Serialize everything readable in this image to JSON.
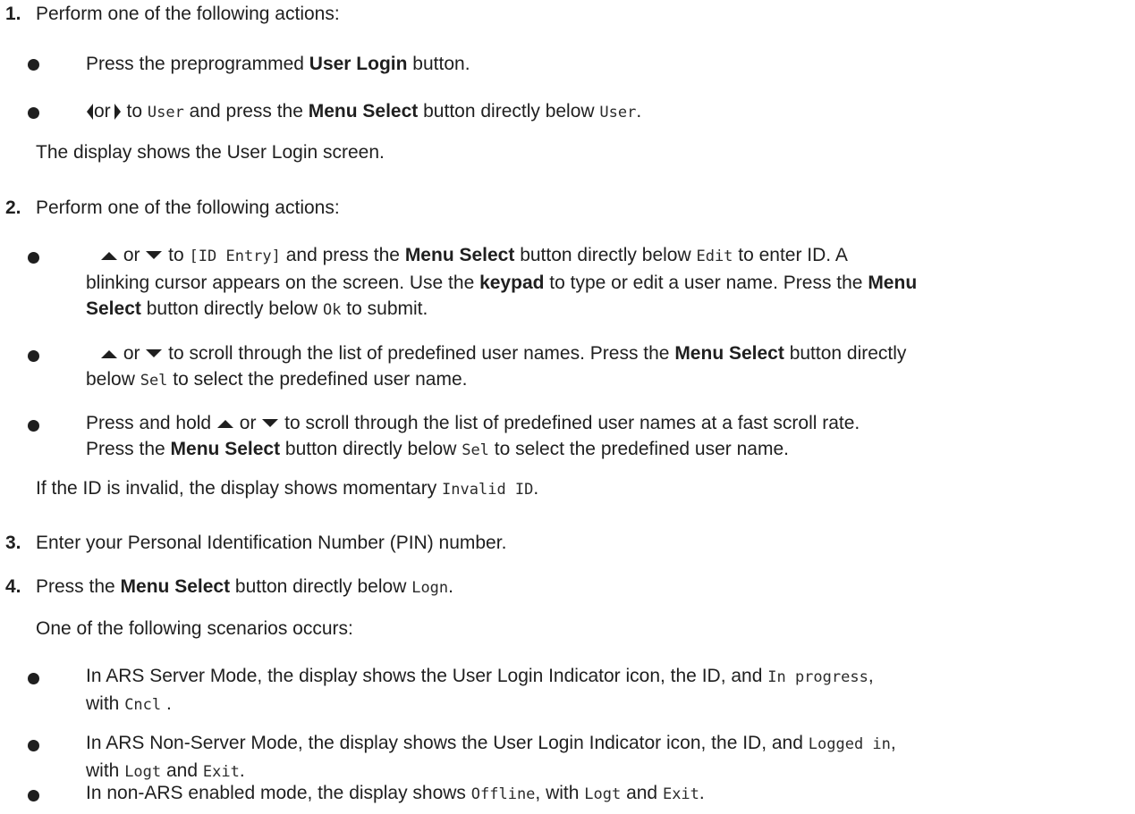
{
  "steps": [
    {
      "number": "1.",
      "text": "Perform one of the following actions:"
    },
    {
      "number": "2.",
      "text": "Perform one of the following actions:"
    },
    {
      "number": "3.",
      "text": "Enter your Personal Identification Number (PIN) number."
    },
    {
      "number": "4.",
      "text": "Press the "
    }
  ],
  "step1": {
    "b1": {
      "pre": "Press the preprogrammed ",
      "bold": "User Login",
      "post": " button."
    },
    "b2": {
      "or": "or",
      "to": " to ",
      "code1": "User",
      "mid": " and press the ",
      "bold": "Menu Select",
      "mid2": " button directly below ",
      "code2": "User",
      "end": "."
    },
    "after": "The display shows the User Login screen."
  },
  "step2": {
    "b1": {
      "or": " or ",
      "to": " to ",
      "code1": "[ID Entry]",
      "mid": " and press the ",
      "bold1": "Menu Select",
      "mid2": " button directly below ",
      "code2": "Edit",
      "mid3": " to enter ID. A",
      "line2a": "blinking cursor appears on the screen. Use the ",
      "bold2": "keypad",
      "line2b": " to type or edit a user name. Press the ",
      "bold3": "Menu",
      "bold4": "Select",
      "line3": " button directly below ",
      "code3": "Ok",
      "end": " to submit."
    },
    "b2": {
      "or": " or ",
      "line1": " to scroll through the list of predefined user names. Press the ",
      "bold": "Menu Select",
      "line1b": " button directly",
      "line2": "below ",
      "code": "Sel",
      "end": " to select the predefined user name."
    },
    "b3": {
      "pre": "Press and hold ",
      "or": " or ",
      "line1": " to scroll through the list of predefined user names at a fast scroll rate.",
      "line2": "Press the ",
      "bold": "Menu Select",
      "line2b": " button directly below ",
      "code": "Sel",
      "end": " to select the predefined user name."
    },
    "after_pre": "If the ID is invalid, the display shows momentary ",
    "after_code": "Invalid ID",
    "after_end": "."
  },
  "step4": {
    "bold": "Menu Select",
    "mid": " button directly below ",
    "code": "Logn",
    "end": ".",
    "sub": "One of the following scenarios occurs:",
    "b1": {
      "pre": "In ARS Server Mode, the display shows the User Login Indicator icon, the ID, and ",
      "code1": "In progress",
      "comma": ",",
      "line2": "with ",
      "code2": "Cncl",
      "end": " ."
    },
    "b2": {
      "pre": "In ARS Non-Server Mode, the display shows the User Login Indicator icon, the ID, and ",
      "code1": "Logged in",
      "comma": ",",
      "line2": "with ",
      "code2": "Logt",
      "and": " and ",
      "code3": "Exit",
      "end": "."
    },
    "b3": {
      "pre": "In non-ARS enabled mode, the display shows ",
      "code1": "Offline",
      "mid": ", with ",
      "code2": "Logt",
      "and": " and ",
      "code3": "Exit",
      "end": "."
    }
  }
}
